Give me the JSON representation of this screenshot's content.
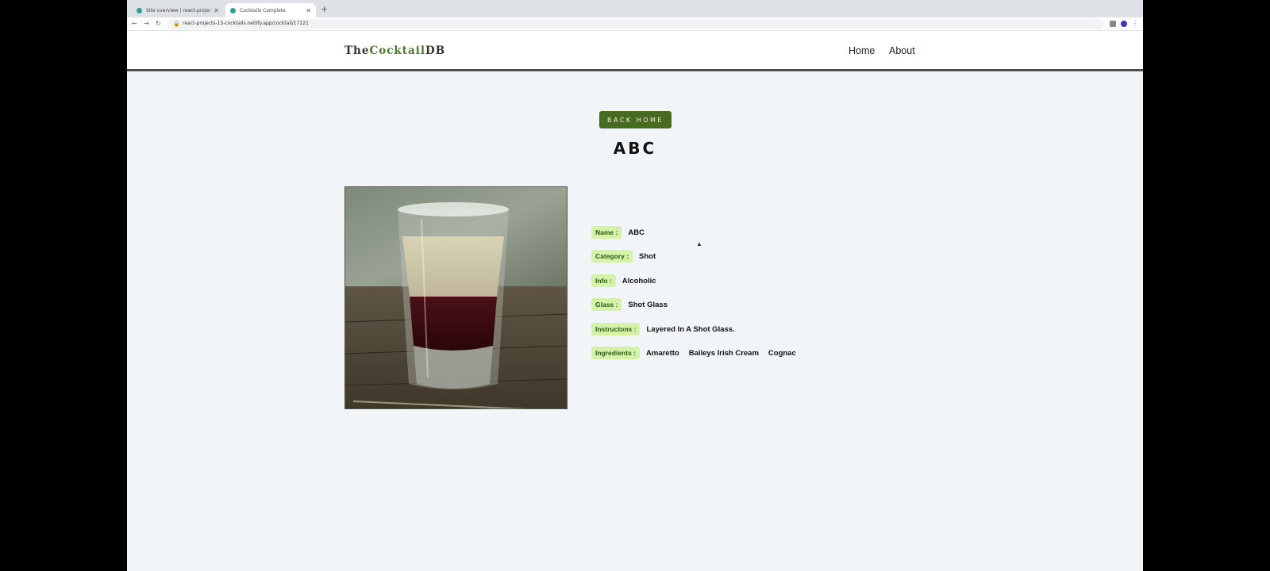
{
  "browser": {
    "tabs": [
      {
        "title": "Site overview | react-projects",
        "active": false
      },
      {
        "title": "Cocktails Complete",
        "active": true
      }
    ],
    "url": "react-projects-15-cocktails.netlify.app/cocktail/17221",
    "accent": "#2aa198"
  },
  "navbar": {
    "logo_prefix": "The",
    "logo_middle": "Cocktail",
    "logo_suffix": "DB",
    "links": [
      "Home",
      "About"
    ]
  },
  "page": {
    "back_label": "back home",
    "title": "ABC"
  },
  "drink": {
    "rows": [
      {
        "label": "Name :",
        "values": [
          "ABC"
        ]
      },
      {
        "label": "Category :",
        "values": [
          "Shot"
        ]
      },
      {
        "label": "Info :",
        "values": [
          "Alcoholic"
        ]
      },
      {
        "label": "Glass :",
        "values": [
          "Shot Glass"
        ]
      },
      {
        "label": "Instructons :",
        "values": [
          "Layered In A Shot Glass."
        ]
      },
      {
        "label": "Ingredients :",
        "values": [
          "Amaretto",
          "Baileys Irish Cream",
          "Cognac"
        ]
      }
    ]
  },
  "colors": {
    "brand_green": "#476b20",
    "label_bg": "#d4f2a8",
    "page_bg": "#f1f5f8"
  }
}
